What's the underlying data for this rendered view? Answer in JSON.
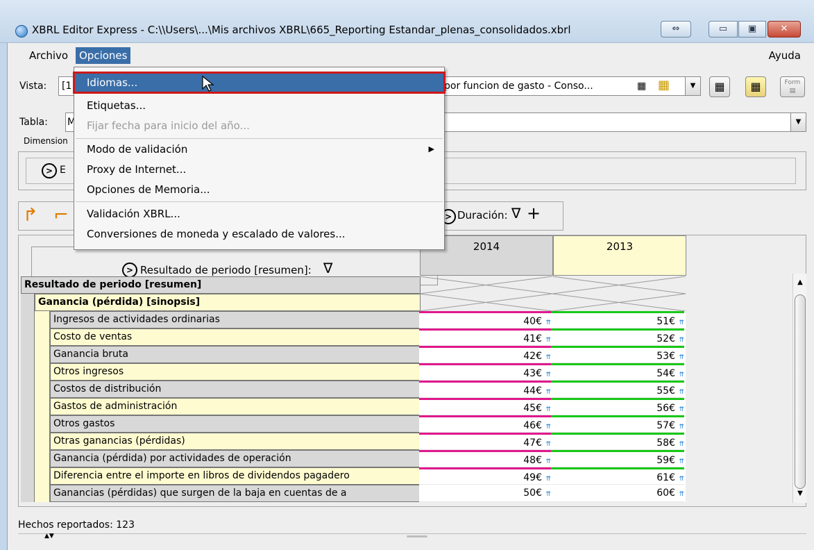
{
  "window": {
    "title": "XBRL Editor Express - C:\\\\Users\\...\\Mis archivos XBRL\\665_Reporting Estandar_plenas_consolidados.xbrl",
    "resize_icon": "⇔",
    "minimize_icon": "▭",
    "maximize_icon": "▣",
    "close_icon": "✕"
  },
  "menubar": {
    "archivo": "Archivo",
    "opciones": "Opciones",
    "ayuda": "Ayuda"
  },
  "vista": {
    "label": "Vista:",
    "value_visible_start": "[1",
    "value_visible_end": "por funcion de gasto - Conso..."
  },
  "tabla": {
    "label": "Tabla:",
    "value_visible_start": "M"
  },
  "dimensions": {
    "label": "Dimension",
    "entry_prefix": "E"
  },
  "toolbar": {
    "duracion_label": "Duración:",
    "filter_symbol": "∇",
    "add_symbol": "+"
  },
  "grid": {
    "row_header_title": "Resultado de periodo [resumen]:",
    "columns": [
      "2014",
      "2013"
    ],
    "rows": [
      {
        "label": "Resultado de periodo [resumen]",
        "level": 0,
        "style": "bold-gray",
        "v2014": "",
        "v2013": ""
      },
      {
        "label": "Ganancia (pérdida) [sinopsis]",
        "level": 1,
        "style": "bold-yellow",
        "v2014": "",
        "v2013": ""
      },
      {
        "label": "Ingresos de actividades ordinarias",
        "level": 2,
        "style": "gray",
        "v2014": "40€",
        "v2013": "51€"
      },
      {
        "label": "Costo de ventas",
        "level": 2,
        "style": "yellow",
        "v2014": "41€",
        "v2013": "52€"
      },
      {
        "label": "Ganancia bruta",
        "level": 2,
        "style": "gray",
        "v2014": "42€",
        "v2013": "53€"
      },
      {
        "label": "Otros ingresos",
        "level": 2,
        "style": "yellow",
        "v2014": "43€",
        "v2013": "54€"
      },
      {
        "label": "Costos de distribución",
        "level": 2,
        "style": "gray",
        "v2014": "44€",
        "v2013": "55€"
      },
      {
        "label": "Gastos de administración",
        "level": 2,
        "style": "yellow",
        "v2014": "45€",
        "v2013": "56€"
      },
      {
        "label": "Otros gastos",
        "level": 2,
        "style": "gray",
        "v2014": "46€",
        "v2013": "57€"
      },
      {
        "label": "Otras ganancias (pérdidas)",
        "level": 2,
        "style": "yellow",
        "v2014": "47€",
        "v2013": "58€"
      },
      {
        "label": "Ganancia (pérdida) por actividades de operación",
        "level": 2,
        "style": "gray",
        "v2014": "48€",
        "v2013": "59€"
      },
      {
        "label": "Diferencia entre el importe en libros de dividendos pagadero",
        "level": 2,
        "style": "yellow",
        "v2014": "49€",
        "v2013": "61€"
      },
      {
        "label": "Ganancias (pérdidas) que surgen de la baja en cuentas de a",
        "level": 2,
        "style": "gray",
        "v2014": "50€",
        "v2013": "60€"
      }
    ]
  },
  "status": {
    "text": "Hechos reportados: 123"
  },
  "dropdown": {
    "items": [
      {
        "label": "Idiomas...",
        "state": "highlighted"
      },
      {
        "label": "Etiquetas...",
        "state": "normal"
      },
      {
        "label": "Fijar fecha para inicio del año...",
        "state": "disabled"
      },
      {
        "label": "Modo de validación",
        "state": "submenu"
      },
      {
        "label": "Proxy de Internet...",
        "state": "normal"
      },
      {
        "label": "Opciones de Memoria...",
        "state": "normal"
      },
      {
        "label": "Validación XBRL...",
        "state": "normal"
      },
      {
        "label": "Conversiones de moneda y escalado de valores...",
        "state": "normal"
      }
    ]
  },
  "colors": {
    "highlight": "#3a6ea8",
    "focus_outline": "#d01818",
    "row_gray": "#d8d8d8",
    "row_yellow": "#fffbd0",
    "marker_2014": "#e0188c",
    "marker_2013": "#18c818"
  }
}
